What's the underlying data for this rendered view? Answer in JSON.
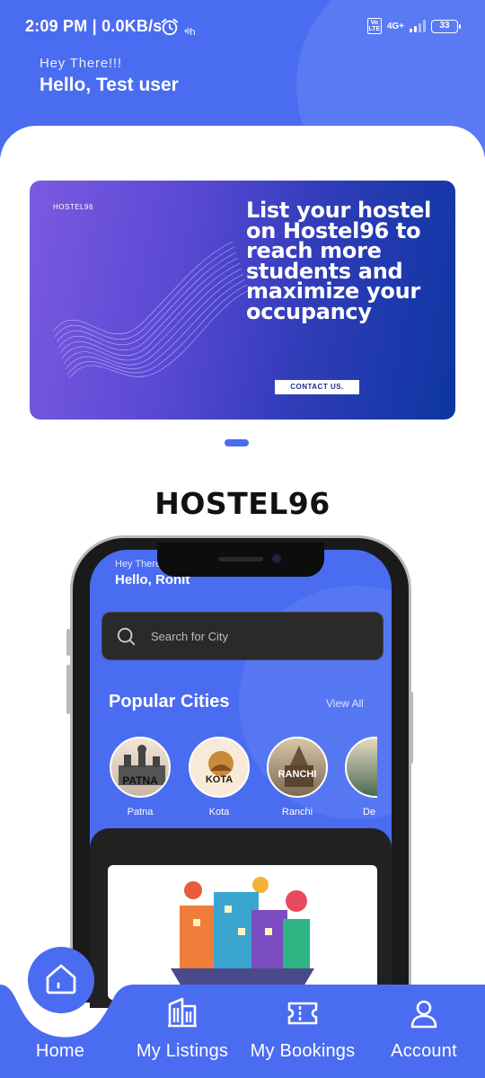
{
  "status_bar": {
    "time_speed": "2:09 PM | 0.0KB/s",
    "small_indicator": "ᢀh",
    "volte": "Vo LTE",
    "network": "4G+",
    "battery": "33"
  },
  "header": {
    "greeting": "Hey There!!!",
    "username": "Hello, Test user"
  },
  "banner": {
    "brand": "HOSTEL96",
    "headline": "List your hostel on Hostel96 to reach more students and maximize your occupancy",
    "cta": "CONTACT US."
  },
  "promo": {
    "title": "HOSTEL96",
    "mockup": {
      "greeting": "Hey There",
      "username": "Hello, Ronit",
      "search_placeholder": "Search for City",
      "section_title": "Popular Cities",
      "view_all": "View All",
      "cities": [
        {
          "name": "Patna",
          "badge": "PATNA"
        },
        {
          "name": "Kota",
          "badge": "KOTA"
        },
        {
          "name": "Ranchi",
          "badge": "RANCHI"
        },
        {
          "name": "De",
          "badge": ""
        }
      ]
    }
  },
  "bottom_nav": {
    "items": [
      {
        "label": "Home",
        "icon": "home-icon",
        "active": true
      },
      {
        "label": "My Listings",
        "icon": "building-icon",
        "active": false
      },
      {
        "label": "My Bookings",
        "icon": "ticket-icon",
        "active": false
      },
      {
        "label": "Account",
        "icon": "person-icon",
        "active": false
      }
    ]
  },
  "colors": {
    "primary": "#4a6cf1",
    "banner_dark": "#0d36a2",
    "banner_light": "#7b5ae0"
  }
}
